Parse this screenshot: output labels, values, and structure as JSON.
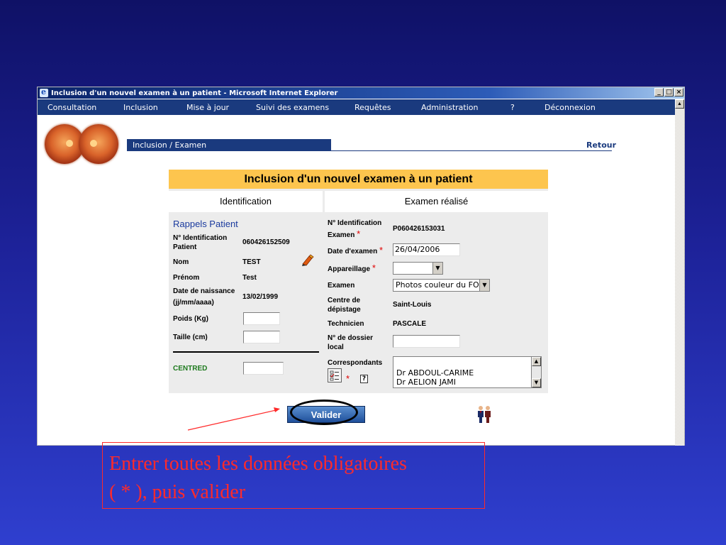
{
  "window": {
    "title": "Inclusion d'un nouvel examen à un patient - Microsoft Internet Explorer",
    "buttons": [
      "_",
      "□",
      "×"
    ]
  },
  "menu": {
    "items": [
      "Consultation",
      "Inclusion",
      "Mise à jour",
      "Suivi des examens",
      "Requêtes",
      "Administration",
      "?",
      "Déconnexion"
    ]
  },
  "header": {
    "breadcrumb": "Inclusion / Examen",
    "back_link": "Retour"
  },
  "form": {
    "title": "Inclusion d'un nouvel examen à un patient",
    "col_identification": "Identification",
    "col_examen": "Examen réalisé",
    "patient": {
      "section_title": "Rappels Patient",
      "id_label_1": "N° Identification",
      "id_label_2": "Patient",
      "id_value": "060426152509",
      "nom_label": "Nom",
      "nom_value": "TEST",
      "prenom_label": "Prénom",
      "prenom_value": "Test",
      "dob_label_1": "Date de naissance",
      "dob_label_2": "(jj/mm/aaaa)",
      "dob_value": "13/02/1999",
      "poids_label": "Poids (Kg)",
      "poids_value": "",
      "taille_label": "Taille (cm)",
      "taille_value": "",
      "centred_label": "CENTRED",
      "centred_value": ""
    },
    "examen": {
      "id_label_1": "N° Identification",
      "id_label_2": "Examen",
      "id_value": "P060426153031",
      "date_label": "Date d'examen",
      "date_value": "26/04/2006",
      "appareillage_label": "Appareillage",
      "appareillage_value": "",
      "examen_label": "Examen",
      "examen_value": "Photos couleur du FO",
      "centre_label_1": "Centre de",
      "centre_label_2": "dépistage",
      "centre_value": "Saint-Louis",
      "technicien_label": "Technicien",
      "technicien_value": "PASCALE",
      "dossier_label_1": "N° de dossier",
      "dossier_label_2": "local",
      "dossier_value": "",
      "correspondants_label": "Correspondants",
      "correspondants": [
        "Dr ABDOUL-CARIME",
        "Dr AELION JAMI"
      ],
      "required_mark": "*",
      "help_mark": "?"
    },
    "submit_label": "Valider"
  },
  "note": {
    "line1": "Entrer toutes les données obligatoires",
    "line2": "( * ), puis valider"
  },
  "colors": {
    "navy": "#1a3a7e",
    "form_title_bg": "#fdc54e",
    "required": "#e00000",
    "note": "#ff2a2a"
  }
}
